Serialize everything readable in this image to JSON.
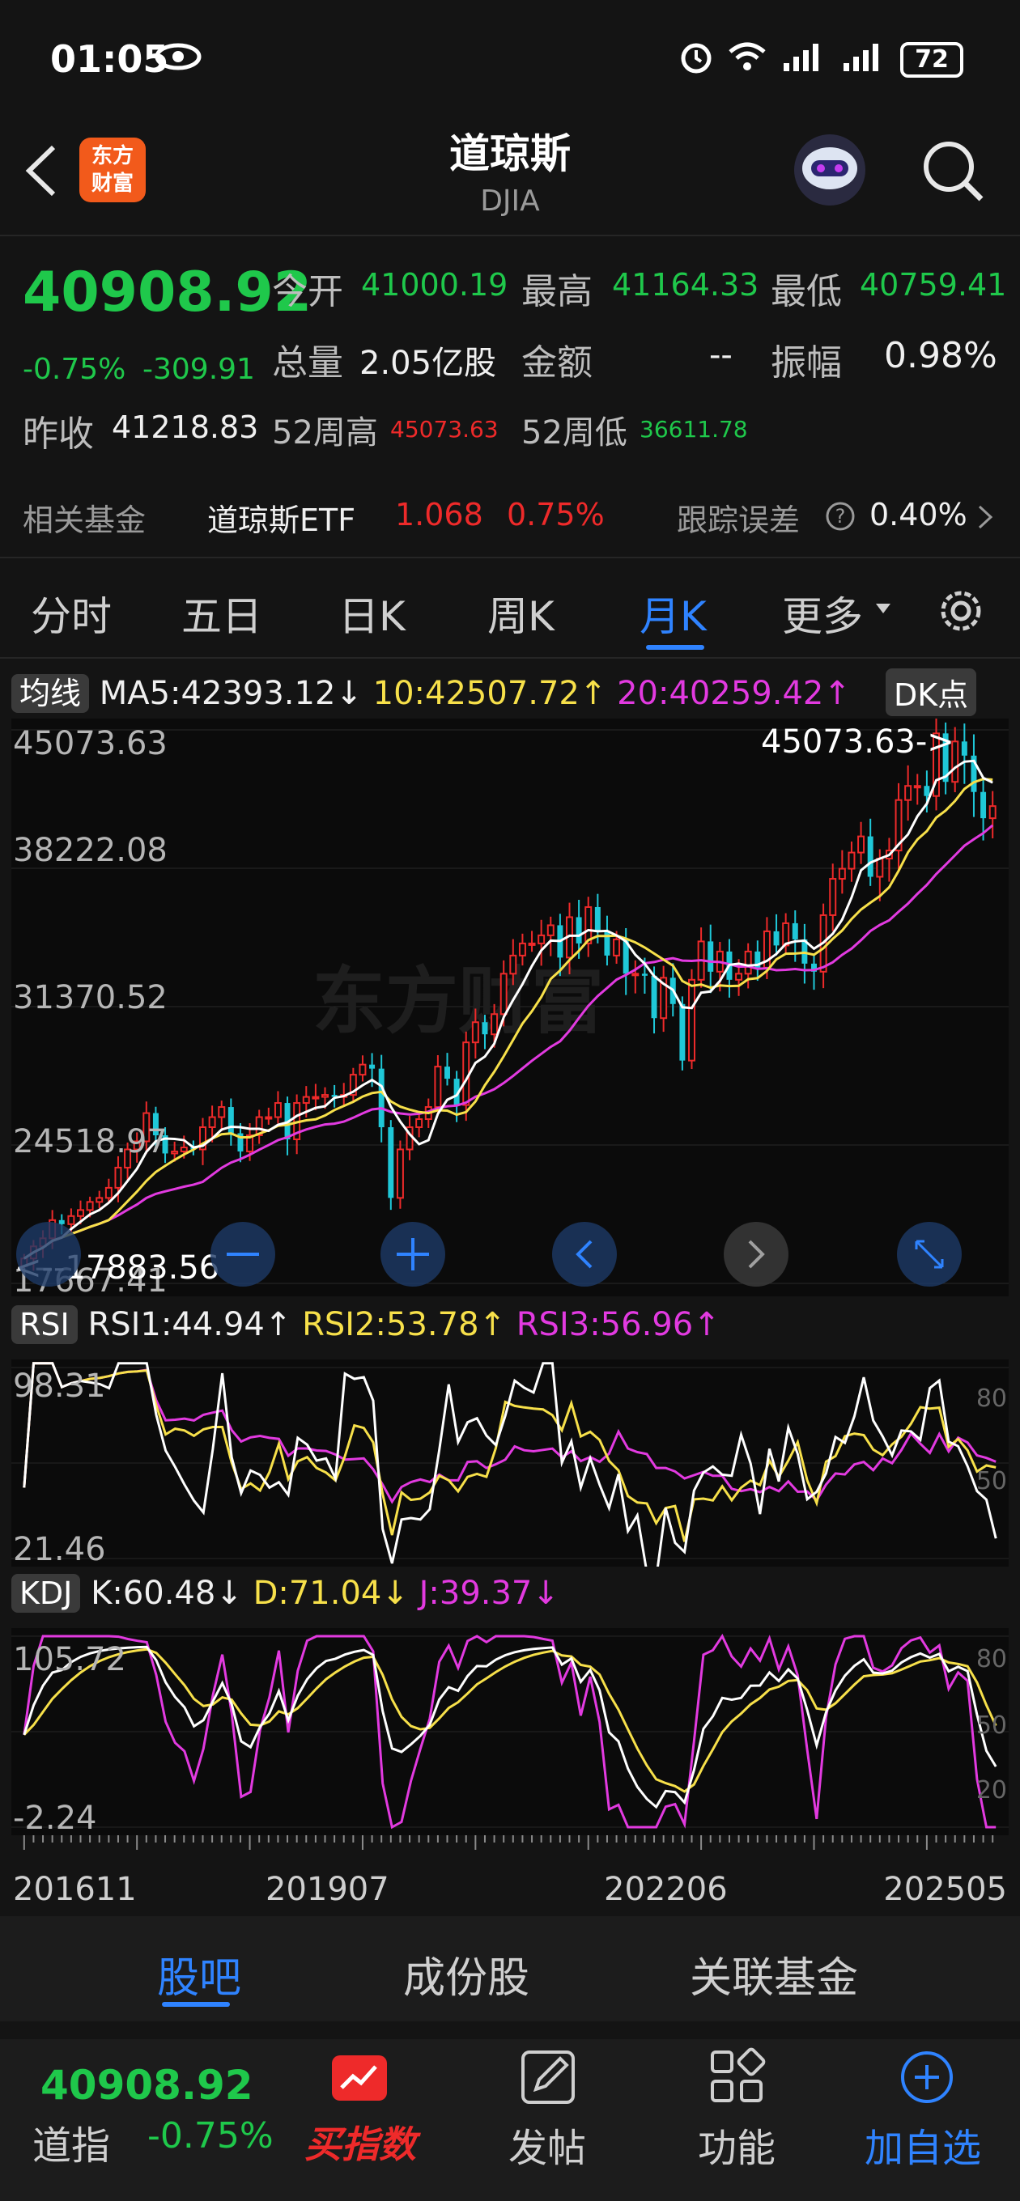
{
  "status": {
    "time": "01:05",
    "battery": "72"
  },
  "header": {
    "title": "道琼斯",
    "subtitle": "DJIA",
    "logo_line1": "东方",
    "logo_line2": "财富"
  },
  "quote": {
    "price": "40908.92",
    "change_pct": "-0.75%",
    "change": "-309.91",
    "open_label": "今开",
    "open": "41000.19",
    "high_label": "最高",
    "high": "41164.33",
    "low_label": "最低",
    "low": "40759.41",
    "volume_label": "总量",
    "volume": "2.05亿股",
    "amount_label": "金额",
    "amount": "--",
    "amplitude_label": "振幅",
    "amplitude": "0.98%",
    "prev_close_label": "昨收",
    "prev_close": "41218.83",
    "week52_high_label": "52周高",
    "week52_high": "45073.63",
    "week52_low_label": "52周低",
    "week52_low": "36611.78"
  },
  "fund": {
    "label": "相关基金",
    "name": "道琼斯ETF",
    "price": "1.068",
    "pct": "0.75%",
    "tracking_label": "跟踪误差",
    "tracking_value": "0.40%"
  },
  "tabs": [
    "分时",
    "五日",
    "日K",
    "周K",
    "月K",
    "更多"
  ],
  "active_tab": "月K",
  "ma": {
    "label": "均线",
    "ma5": "MA5:42393.12↓",
    "ma10": "10:42507.72↑",
    "ma20": "20:40259.42↑",
    "dk": "DK点"
  },
  "main_chart": {
    "y_labels": [
      "45073.63",
      "38222.08",
      "31370.52",
      "24518.97",
      "17667.41"
    ],
    "max_marker": "45073.63->",
    "min_marker": "<--17883.56",
    "watermark": "东方财富"
  },
  "rsi": {
    "label": "RSI",
    "rsi1": "RSI1:44.94↑",
    "rsi2": "RSI2:53.78↑",
    "rsi3": "RSI3:56.96↑",
    "top": "98.31",
    "bottom": "21.46",
    "r80": "80",
    "r50": "50"
  },
  "kdj": {
    "label": "KDJ",
    "k": "K:60.48↓",
    "d": "D:71.04↓",
    "j": "J:39.37↓",
    "top": "105.72",
    "bottom": "-2.24",
    "r80": "80",
    "r50": "50",
    "r20": "20"
  },
  "x_axis": [
    "201611",
    "201907",
    "202206",
    "202505"
  ],
  "chart_data": {
    "type": "candlestick",
    "period": "monthly",
    "x_start": "201611",
    "x_end": "202505",
    "ylim": [
      17667.41,
      45073.63
    ],
    "closes": [
      18900,
      19500,
      19900,
      20800,
      20600,
      21000,
      21300,
      21700,
      21900,
      22400,
      23400,
      24300,
      24700,
      26100,
      25000,
      24100,
      24200,
      24400,
      24300,
      25400,
      25900,
      26400,
      25100,
      24200,
      25000,
      25900,
      25900,
      26600,
      24800,
      26600,
      26900,
      26900,
      27000,
      26900,
      27000,
      28000,
      28500,
      28300,
      25400,
      21900,
      24300,
      25400,
      25800,
      26400,
      28400,
      27800,
      26500,
      29600,
      30600,
      30000,
      31000,
      33000,
      33900,
      34500,
      34500,
      34900,
      35400,
      33800,
      35800,
      34500,
      36300,
      35100,
      33900,
      34700,
      33000,
      33000,
      32900,
      30800,
      32800,
      31500,
      28700,
      32700,
      34600,
      33100,
      34100,
      32700,
      33000,
      34100,
      33300,
      35100,
      34400,
      35500,
      34700,
      33500,
      33100,
      35900,
      37700,
      38200,
      39000,
      39800,
      37800,
      38700,
      39100,
      41600,
      42300,
      42300,
      41800,
      44900,
      42500,
      44500,
      43800,
      42000,
      40700,
      41300
    ]
  },
  "bottom_tabs": [
    "股吧",
    "成份股",
    "关联基金"
  ],
  "footer": {
    "index_price": "40908.92",
    "index_name": "道指",
    "index_pct": "-0.75%",
    "buy": "买指数",
    "post": "发帖",
    "functions": "功能",
    "add": "加自选"
  },
  "colors": {
    "up": "#ee2a2a",
    "down": "#1fc8d8",
    "ma5": "#ffffff",
    "ma10": "#f7e04a",
    "ma20": "#e23ae0",
    "accent": "#2f83ff"
  }
}
